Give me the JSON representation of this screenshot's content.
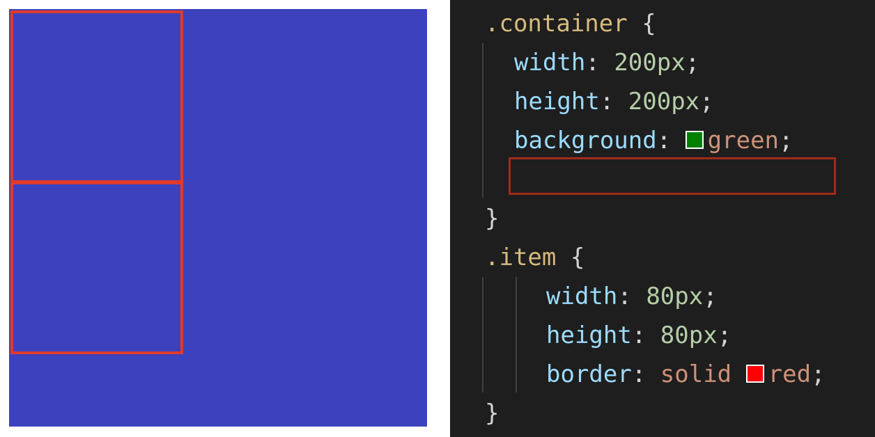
{
  "preview": {
    "background": "#3c42bd",
    "item_border": "#e03a2c"
  },
  "code": {
    "container_selector": ".container",
    "item_selector": ".item",
    "open_brace": "{",
    "close_brace": "}",
    "container_props": [
      {
        "name": "width",
        "value": "200px"
      },
      {
        "name": "height",
        "value": "200px"
      },
      {
        "name": "background",
        "value": "green",
        "swatch": "#008000"
      }
    ],
    "item_props": [
      {
        "name": "width",
        "value": "80px"
      },
      {
        "name": "height",
        "value": "80px"
      },
      {
        "name": "border",
        "keyword": "solid",
        "value": "red",
        "swatch": "#ff0000"
      }
    ],
    "colon": ":",
    "semicolon": ";"
  }
}
